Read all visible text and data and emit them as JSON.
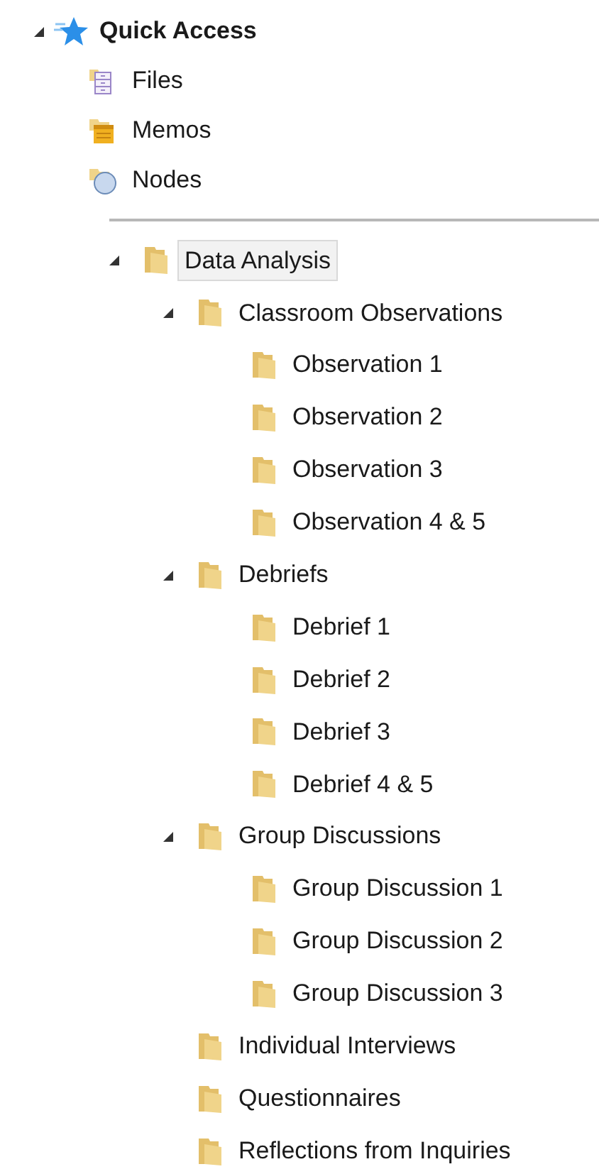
{
  "quick_access": {
    "label": "Quick Access",
    "expanded": true,
    "items": [
      {
        "label": "Files",
        "kind": "files"
      },
      {
        "label": "Memos",
        "kind": "memos"
      },
      {
        "label": "Nodes",
        "kind": "nodes"
      }
    ]
  },
  "tree": [
    {
      "label": "Data Analysis",
      "expanded": true,
      "selected": true,
      "children": [
        {
          "label": "Classroom Observations",
          "expanded": true,
          "selected": false,
          "children": [
            {
              "label": "Observation 1",
              "selected": false
            },
            {
              "label": "Observation 2",
              "selected": false
            },
            {
              "label": "Observation 3",
              "selected": false
            },
            {
              "label": "Observation 4 & 5",
              "selected": false
            }
          ]
        },
        {
          "label": "Debriefs",
          "expanded": true,
          "selected": false,
          "children": [
            {
              "label": "Debrief 1",
              "selected": false
            },
            {
              "label": "Debrief 2",
              "selected": false
            },
            {
              "label": "Debrief 3",
              "selected": false
            },
            {
              "label": "Debrief 4 & 5",
              "selected": false
            }
          ]
        },
        {
          "label": "Group Discussions",
          "expanded": true,
          "selected": false,
          "children": [
            {
              "label": "Group Discussion 1",
              "selected": false
            },
            {
              "label": "Group Discussion 2",
              "selected": false
            },
            {
              "label": "Group Discussion 3",
              "selected": false
            }
          ]
        },
        {
          "label": "Individual Interviews",
          "selected": false
        },
        {
          "label": "Questionnaires",
          "selected": false
        },
        {
          "label": "Reflections from Inquiries",
          "selected": false
        }
      ]
    }
  ]
}
